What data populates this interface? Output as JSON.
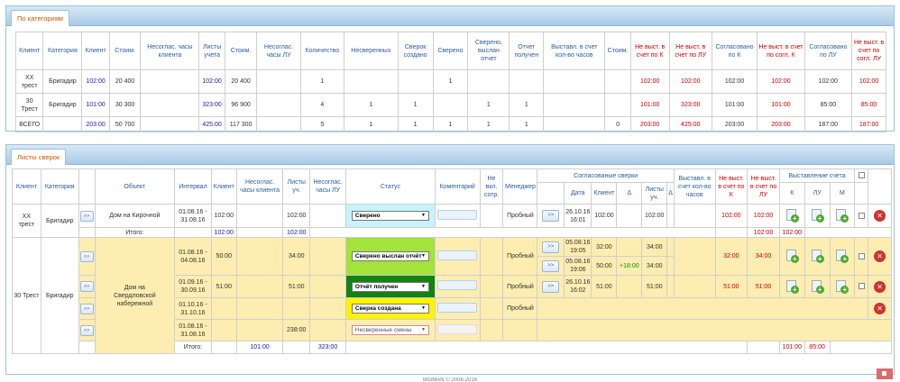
{
  "panel1": {
    "tab": "По категориям",
    "headers": [
      "Клиент",
      "Категория",
      "Клиент",
      "Стоим.",
      "Несоглас. часы клиента",
      "Листы учета",
      "Стоим.",
      "Несоглас. часы ЛУ",
      "Количество",
      "Несверенных",
      "Сверок создано",
      "Сверено",
      "Сверено, выслан отчет",
      "Отчет получен",
      "Выставл. в счет кол-во часов",
      "Стоим.",
      "Не выст. в счет по К",
      "Не выст. в счет по ЛУ",
      "Согласовано по К",
      "Не выст. в счет по согл. К",
      "Согласовано по ЛУ",
      "Не выст. в счет по согл. ЛУ"
    ],
    "rows": [
      [
        "ХХ трест",
        "Бригадир",
        "102:00",
        "20 400",
        "",
        "102:00",
        "20 400",
        "",
        "1",
        "",
        "",
        "1",
        "",
        "",
        "",
        "",
        "102:00",
        "102:00",
        "102:00",
        "102:00",
        "102:00",
        "102:00"
      ],
      [
        "30 Трест",
        "Бригадир",
        "101:00",
        "30 300",
        "",
        "323:00",
        "96 900",
        "",
        "4",
        "1",
        "1",
        "",
        "1",
        "1",
        "",
        "",
        "101:00",
        "323:00",
        "101:00",
        "101:00",
        "85:00",
        "85:00"
      ],
      [
        "ВСЕГО",
        "",
        "203:00",
        "50 700",
        "",
        "425:00",
        "117 300",
        "",
        "5",
        "1",
        "1",
        "1",
        "1",
        "1",
        "",
        "0",
        "203:00",
        "425:00",
        "203:00",
        "203:00",
        "187:00",
        "187:00"
      ]
    ]
  },
  "panel2": {
    "tab": "Листы сверок",
    "headers": {
      "client": "Клиент",
      "category": "Категория",
      "object": "Объект",
      "interval": "Интервал",
      "client2": "Клиент",
      "unagreed_client": "Несоглас. часы клиента",
      "sheets": "Листы уч.",
      "unagreed_lu": "Несоглас. часы ЛУ",
      "status": "Статус",
      "comment": "Коментарий",
      "not_included": "Не вкл. сотр.",
      "manager": "Менеджер",
      "agreed_group": "Согласованые сверки",
      "date": "Дата",
      "agreed_client": "Клиент",
      "delta": "Δ",
      "agreed_sheets": "Листы уч.",
      "delta2": "Δ",
      "billed_hours": "Выставл. в счет кол-во часов",
      "not_billed_k": "Не выст. в счет по К",
      "not_billed_lu": "Не выст. в счет по ЛУ",
      "invoice_group": "Выставление счета",
      "inv_k": "К",
      "inv_lu": "ЛУ",
      "inv_m": "М"
    },
    "buttons": {
      "go": ">>"
    },
    "trust1": {
      "client": "ХХ трест",
      "category": "Бригадир",
      "object": "Дом на Кирочной",
      "interval": "01.08.16 - 31.08.16",
      "client_hours": "102:00",
      "sheets": "102:00",
      "status": "Сверено",
      "manager": "Пробный",
      "agreed_date": "26.10.16 16:01",
      "agreed_client": "102:00",
      "agreed_sheets": "102:00",
      "not_billed_k": "102:00",
      "not_billed_lu": "102:00",
      "total_label": "Итого:",
      "total_client": "102:00",
      "total_sheets": "102:00",
      "total_k": "102:00",
      "total_lu": "102:00"
    },
    "trust2": {
      "client": "30 Трест",
      "category": "Бригадир",
      "object": "Дом на Свердловской набережной",
      "rows": [
        {
          "interval": "01.08.16 - 04.08.16",
          "client_hours": "50:00",
          "sheets": "34:00",
          "status": "Сверено выслан отчёт",
          "manager": "Пробный",
          "not_billed_k": "32:00",
          "not_billed_lu": "34:00"
        },
        {
          "interval": "01.09.16 - 30.09.16",
          "client_hours": "51:00",
          "sheets": "51:00",
          "status": "Отчёт получен",
          "manager": "Пробный",
          "not_billed_k": "51:00",
          "not_billed_lu": "51:00",
          "agreed_date": "26.10.16 16:02",
          "agreed_client": "51:00",
          "agreed_sheets": "51:00"
        },
        {
          "interval": "01.10.16 - 31.10.16",
          "client_hours": "",
          "sheets": "",
          "status": "Сверка создана",
          "manager": "Пробный"
        },
        {
          "interval": "01.08.16 - 31.08.16",
          "client_hours": "",
          "sheets": "238:00",
          "status": "Несверенные смены",
          "manager": ""
        }
      ],
      "agreed_a": {
        "date": "05.08.16 19:05",
        "client": "32:00",
        "sheets": "34:00"
      },
      "agreed_b": {
        "date": "05.08.16 19:06",
        "client": "50:00",
        "delta": "+18:00",
        "sheets": "34:00"
      },
      "total_label": "Итого:",
      "total_client": "101:00",
      "total_sheets": "323:00",
      "total_k": "101:00",
      "total_lu": "85:00"
    }
  },
  "footer": {
    "text": "BIGMAN © 2008-2016"
  }
}
